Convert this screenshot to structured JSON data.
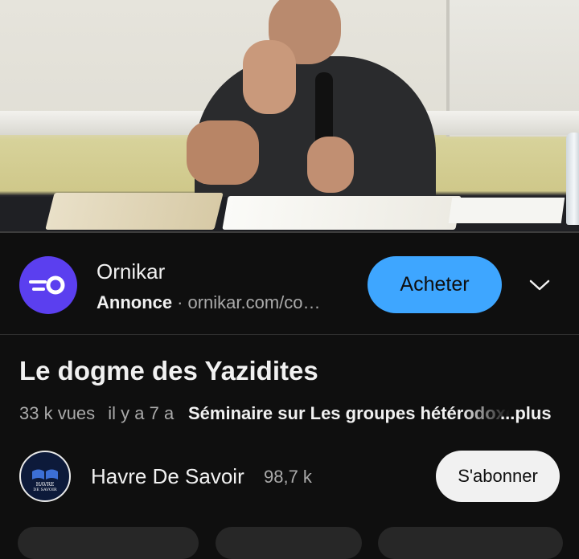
{
  "ad": {
    "advertiser": "Ornikar",
    "badge": "Annonce",
    "separator": "·",
    "url": "ornikar.com/co…",
    "cta_label": "Acheter",
    "logo_icon": "ornikar-logo-icon",
    "expand_icon": "chevron-down-icon"
  },
  "video": {
    "title": "Le dogme des Yazidites",
    "views": "33 k vues",
    "age": "il y a 7 a",
    "series": "Séminaire sur Les groupes hétérodoxes",
    "more_label": "...plus"
  },
  "channel": {
    "name": "Havre De Savoir",
    "subscribers": "98,7 k",
    "subscribe_label": "S'abonner",
    "avatar_icon": "havre-de-savoir-logo",
    "avatar_text_line1": "HAVRE",
    "avatar_text_line2": "DE SAVOIR"
  },
  "colors": {
    "background": "#0f0f0f",
    "accent_blue": "#3ea6ff",
    "ad_logo_purple": "#5b3fef",
    "secondary_text": "#aaaaaa"
  }
}
